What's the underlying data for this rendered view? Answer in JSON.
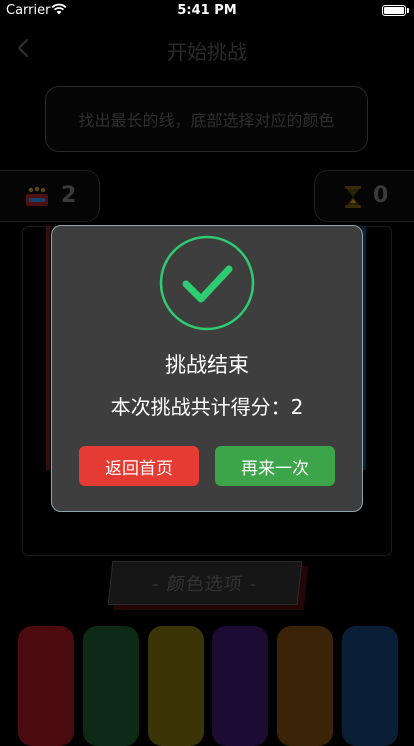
{
  "status": {
    "carrier": "Carrier",
    "time": "5:41 PM",
    "battery_level": 1.0
  },
  "nav": {
    "title": "开始挑战",
    "back_icon": "chevron-left-icon"
  },
  "instruction": "找出最长的线，底部选择对应的颜色",
  "stats": {
    "score_value": "2",
    "score_icon": "tickets-icon",
    "timer_value": "0",
    "timer_icon": "hourglass-icon"
  },
  "options": {
    "label": "- 颜色选项 -",
    "swatches": [
      "#4a0a0e",
      "#0d2a17",
      "#3a3407",
      "#1c0c33",
      "#3a2306",
      "#0a1f37"
    ]
  },
  "dialog": {
    "icon": "checkmark-circle-icon",
    "title": "挑战结束",
    "score_text": "本次挑战共计得分：2",
    "home_button": "返回首页",
    "again_button": "再来一次",
    "accent": "#2ecc71"
  }
}
